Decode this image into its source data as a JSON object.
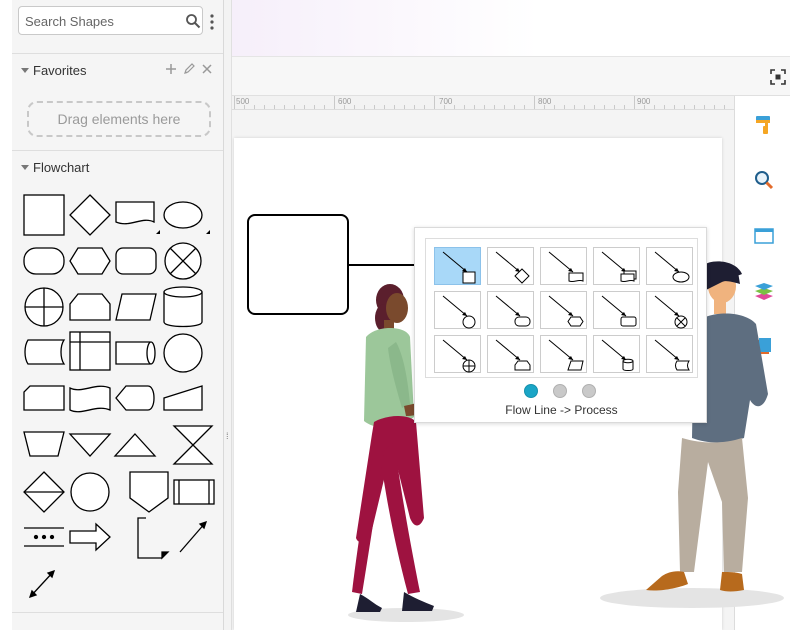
{
  "sidebar": {
    "search": {
      "placeholder": "Search Shapes",
      "icon": "search-icon"
    },
    "favorites": {
      "title": "Favorites",
      "drop_hint": "Drag elements here"
    },
    "flowchart": {
      "title": "Flowchart"
    }
  },
  "ruler": {
    "labels": [
      "500",
      "600",
      "700",
      "800",
      "900"
    ]
  },
  "popup": {
    "caption": "Flow Line -> Process",
    "page_dots": 3,
    "active_dot": 0
  },
  "colors": {
    "accent": "#1aa5c6",
    "selected_cell": "#a8d8f8",
    "skirt": "#9e1240",
    "shirt_left": "#9cc79a",
    "shirt_right": "#5e6e80"
  }
}
